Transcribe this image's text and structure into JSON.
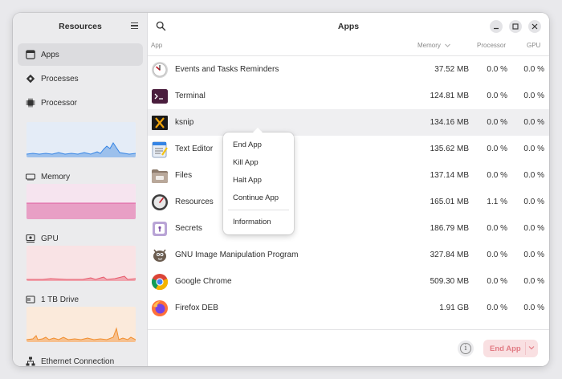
{
  "sidebar": {
    "title": "Resources",
    "items": [
      {
        "label": "Apps"
      },
      {
        "label": "Processes"
      },
      {
        "label": "Processor"
      },
      {
        "label": "Memory"
      },
      {
        "label": "GPU"
      },
      {
        "label": "1 TB Drive"
      },
      {
        "label": "Ethernet Connection"
      }
    ]
  },
  "header": {
    "title": "Apps"
  },
  "columns": {
    "app": "App",
    "memory": "Memory",
    "processor": "Processor",
    "gpu": "GPU"
  },
  "rows": [
    {
      "name": "Events and Tasks Reminders",
      "memory": "37.52 MB",
      "processor": "0.0 %",
      "gpu": "0.0 %",
      "icon": "clock-icon"
    },
    {
      "name": "Terminal",
      "memory": "124.81 MB",
      "processor": "0.0 %",
      "gpu": "0.0 %",
      "icon": "terminal-icon"
    },
    {
      "name": "ksnip",
      "memory": "134.16 MB",
      "processor": "0.0 %",
      "gpu": "0.0 %",
      "icon": "ksnip-icon"
    },
    {
      "name": "Text Editor",
      "memory": "135.62 MB",
      "processor": "0.0 %",
      "gpu": "0.0 %",
      "icon": "text-editor-icon"
    },
    {
      "name": "Files",
      "memory": "137.14 MB",
      "processor": "0.0 %",
      "gpu": "0.0 %",
      "icon": "folder-icon"
    },
    {
      "name": "Resources",
      "memory": "165.01 MB",
      "processor": "1.1 %",
      "gpu": "0.0 %",
      "icon": "resources-icon"
    },
    {
      "name": "Secrets",
      "memory": "186.79 MB",
      "processor": "0.0 %",
      "gpu": "0.0 %",
      "icon": "secrets-icon"
    },
    {
      "name": "GNU Image Manipulation Program",
      "memory": "327.84 MB",
      "processor": "0.0 %",
      "gpu": "0.0 %",
      "icon": "gimp-icon"
    },
    {
      "name": "Google Chrome",
      "memory": "509.30 MB",
      "processor": "0.0 %",
      "gpu": "0.0 %",
      "icon": "chrome-icon"
    },
    {
      "name": "Firefox DEB",
      "memory": "1.91 GB",
      "processor": "0.0 %",
      "gpu": "0.0 %",
      "icon": "firefox-icon"
    }
  ],
  "context_menu": {
    "items": [
      "End App",
      "Kill App",
      "Halt App",
      "Continue App"
    ],
    "info": "Information"
  },
  "footer": {
    "end_app": "End App"
  },
  "colors": {
    "processor_graph": "#3584e4",
    "memory_graph": "#e05ca0",
    "gpu_graph": "#e8596b",
    "drive_graph": "#f18e2e",
    "end_app_text": "#e27b84"
  }
}
